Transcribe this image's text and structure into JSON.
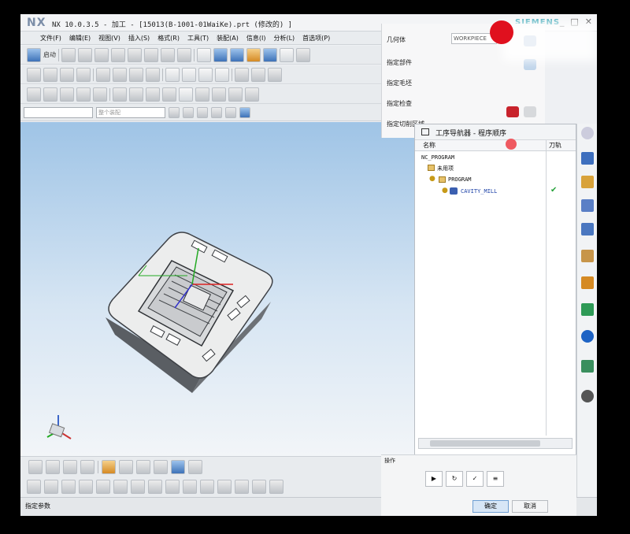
{
  "window": {
    "logo": "NX",
    "title": "NX 10.0.3.5 - 加工 - [15013(B-1001-01WaiKe).prt (修改的) ]",
    "brand": "SIEMENS"
  },
  "menubar": {
    "items": [
      "文件(F)",
      "编辑(E)",
      "视图(V)",
      "插入(S)",
      "格式(R)",
      "工具(T)",
      "装配(A)",
      "信息(I)",
      "分析(L)",
      "首选项(P)"
    ]
  },
  "toolbar": {
    "start_label": "启动"
  },
  "filter": {
    "selection_filter": "",
    "assembly_filter": "整个装配"
  },
  "dialog": {
    "rows": [
      "几何体",
      "指定部件",
      "指定毛坯",
      "指定检查",
      "指定切削区域"
    ],
    "geometry_value": "WORKPIECE"
  },
  "navigator": {
    "title": "工序导航器 - 程序顺序",
    "col_name": "名称",
    "col_tool": "刀轨",
    "nodes": [
      {
        "label": "NC_PROGRAM"
      },
      {
        "label": "未用项"
      },
      {
        "label": "PROGRAM"
      },
      {
        "label": "CAVITY_MILL",
        "checked": "✔"
      }
    ]
  },
  "dialog_bottom": {
    "section_label": "操作",
    "ok": "确定",
    "cancel": "取消"
  },
  "statusbar": {
    "text": "指定参数"
  }
}
